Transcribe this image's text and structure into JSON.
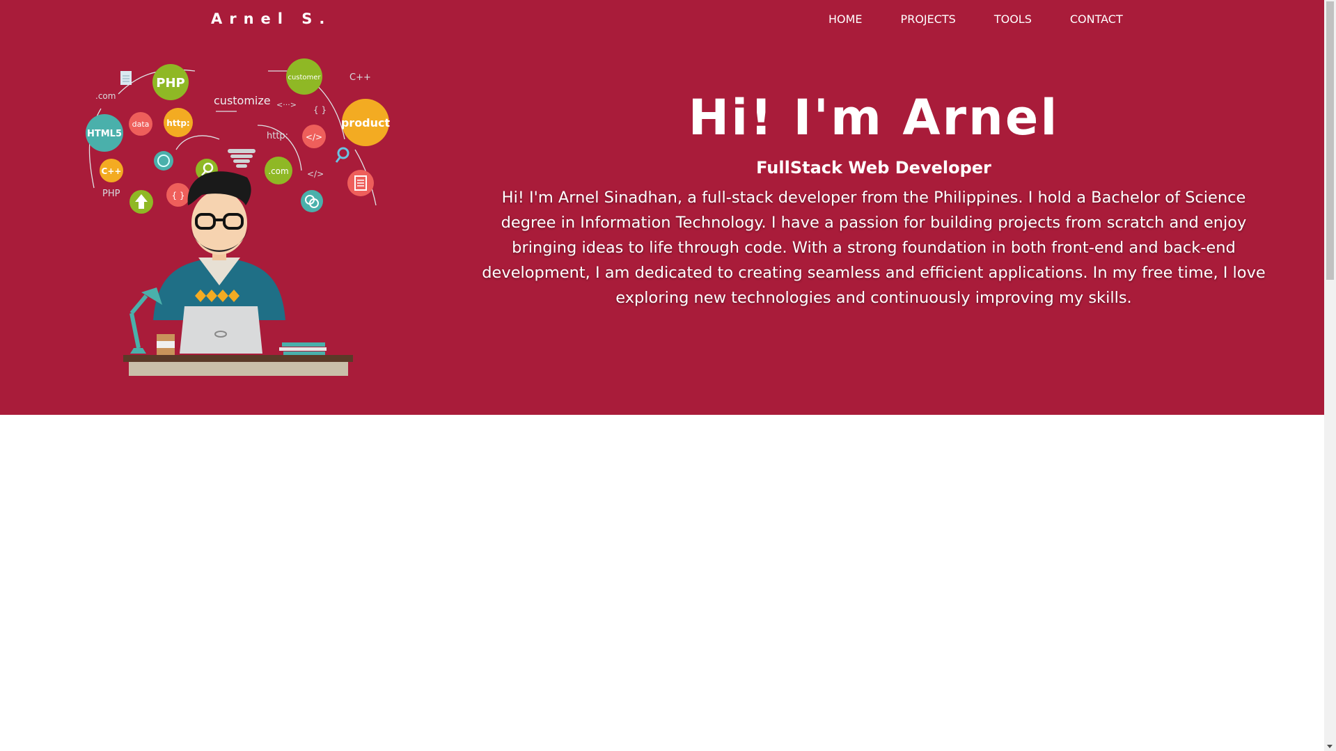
{
  "header": {
    "brand": "Arnel S.",
    "nav": [
      {
        "label": "HOME"
      },
      {
        "label": "PROJECTS"
      },
      {
        "label": "TOOLS"
      },
      {
        "label": "CONTACT"
      }
    ]
  },
  "hero": {
    "title": "Hi! I'm Arnel",
    "subtitle": "FullStack Web Developer",
    "bio": "Hi! I'm Arnel Sinadhan, a full-stack developer from the Philippines. I hold a Bachelor of Science degree in Information Technology. I have a passion for building projects from scratch and enjoy bringing ideas to life through code. With a strong foundation in both front-end and back-end development, I am dedicated to creating seamless and efficient applications. In my free time, I love exploring new technologies and continuously improving my skills."
  },
  "illustration": {
    "labels": {
      "php": "PHP",
      "customer": "customer",
      "cpp_top": "C++",
      "dotcom_left": ".com",
      "customize": "customize",
      "product": "product",
      "html5": "HTML5",
      "data": "data",
      "http_badge": "http:",
      "http_text": "http:",
      "code": "</>",
      "code_text": "</>",
      "cpp_badge": "C++",
      "php_text": "PHP",
      "dotcom_badge": ".com",
      "braces": "{ }",
      "braces_text": "{ }",
      "arrows": "<···>"
    }
  },
  "colors": {
    "hero_bg": "#a91c3a",
    "page_bg": "#ffffff",
    "text": "#ffffff",
    "green": "#8fb825",
    "orange": "#f3ab22",
    "teal": "#4ab0ab",
    "coral": "#ee5f5b"
  }
}
